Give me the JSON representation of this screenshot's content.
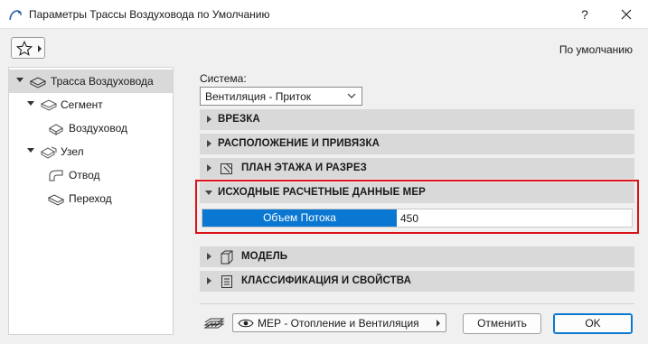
{
  "window": {
    "title": "Параметры Трассы Воздуховода по Умолчанию",
    "help_label": "?"
  },
  "header": {
    "favorites_icon": "star-icon",
    "default_label": "По умолчанию"
  },
  "tree": {
    "items": [
      {
        "label": "Трасса Воздуховода",
        "level": 0,
        "expanded": true,
        "selected": true,
        "icon": "duct-route-icon"
      },
      {
        "label": "Сегмент",
        "level": 1,
        "expanded": true,
        "selected": false,
        "icon": "segment-icon"
      },
      {
        "label": "Воздуховод",
        "level": 2,
        "expanded": false,
        "selected": false,
        "icon": "duct-icon"
      },
      {
        "label": "Узел",
        "level": 1,
        "expanded": true,
        "selected": false,
        "icon": "node-icon"
      },
      {
        "label": "Отвод",
        "level": 2,
        "expanded": false,
        "selected": false,
        "icon": "elbow-icon"
      },
      {
        "label": "Переход",
        "level": 2,
        "expanded": false,
        "selected": false,
        "icon": "transition-icon"
      }
    ]
  },
  "system": {
    "label": "Система:",
    "value": "Вентиляция - Приток"
  },
  "panels": [
    {
      "title": "ВРЕЗКА",
      "expanded": false,
      "icon": ""
    },
    {
      "title": "РАСПОЛОЖЕНИЕ И ПРИВЯЗКА",
      "expanded": false,
      "icon": ""
    },
    {
      "title": "ПЛАН ЭТАЖА И РАЗРЕЗ",
      "expanded": false,
      "icon": "floor-plan-icon"
    },
    {
      "title": "ИСХОДНЫЕ РАСЧЕТНЫЕ ДАННЫЕ МЕР",
      "expanded": true,
      "icon": ""
    },
    {
      "title": "МОДЕЛЬ",
      "expanded": false,
      "icon": "model-cube-icon"
    },
    {
      "title": "КЛАССИФИКАЦИЯ И СВОЙСТВА",
      "expanded": false,
      "icon": "document-list-icon"
    }
  ],
  "mep_data": {
    "param_name": "Объем Потока",
    "param_value": "450"
  },
  "footer": {
    "layer_icon": "layers-icon",
    "layer_value": "МЕР - Отопление и Вентиляция",
    "cancel_label": "Отменить",
    "ok_label": "OK"
  },
  "colors": {
    "accent": "#0a78d2",
    "highlight_frame": "#d8141a",
    "panel_header": "#d9d9d9",
    "tree_selected": "#d9d9d9"
  }
}
